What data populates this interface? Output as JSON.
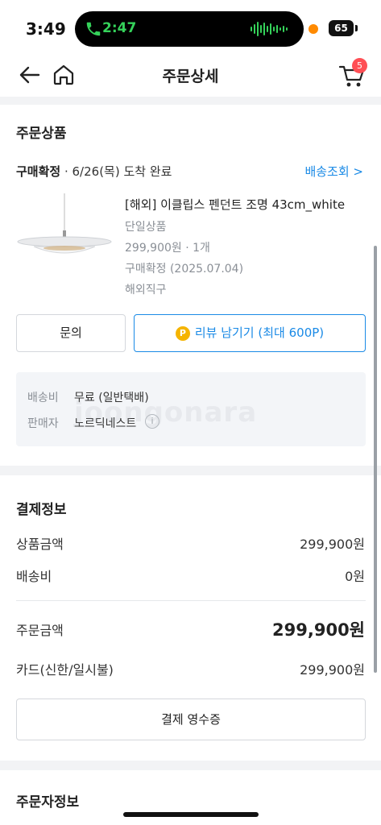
{
  "status_bar": {
    "time": "3:49",
    "call_duration": "2:47",
    "battery": "65"
  },
  "header": {
    "title": "주문상세",
    "cart_count": "5",
    "icons": [
      "back-arrow-icon",
      "home-icon",
      "cart-icon"
    ]
  },
  "order_products": {
    "section_title": "주문상품",
    "status_bold": "구매확정",
    "status_detail": " · 6/26(목) 도착 완료",
    "track_link": "배송조회 >",
    "product": {
      "name": "[해외] 이클립스 펜던트 조명 43cm_white",
      "option": "단일상품",
      "price_qty": "299,900원 · 1개",
      "confirm": "구매확정 (2025.07.04)",
      "type": "해외직구"
    },
    "inquiry_button": "문의",
    "review_coin": "P",
    "review_button": "리뷰 남기기 (최대 600P)",
    "shipping": {
      "fee_label": "배송비",
      "fee_value": "무료 (일반택배)",
      "seller_label": "판매자",
      "seller_value": "노르딕네스트",
      "info_icon": "i"
    },
    "watermark": "joongonara"
  },
  "payment": {
    "section_title": "결제정보",
    "product_amount_label": "상품금액",
    "product_amount_value": "299,900원",
    "shipping_label": "배송비",
    "shipping_value": "0원",
    "order_amount_label": "주문금액",
    "order_amount_value": "299,900원",
    "card_label": "카드(신한/일시불)",
    "card_value": "299,900원",
    "receipt_button": "결제 영수증"
  },
  "orderer": {
    "section_title": "주문자정보"
  },
  "colors": {
    "accent": "#1a8ae6",
    "badge": "#ff4f55",
    "coin": "#f5b400",
    "call_green": "#35d25a"
  }
}
